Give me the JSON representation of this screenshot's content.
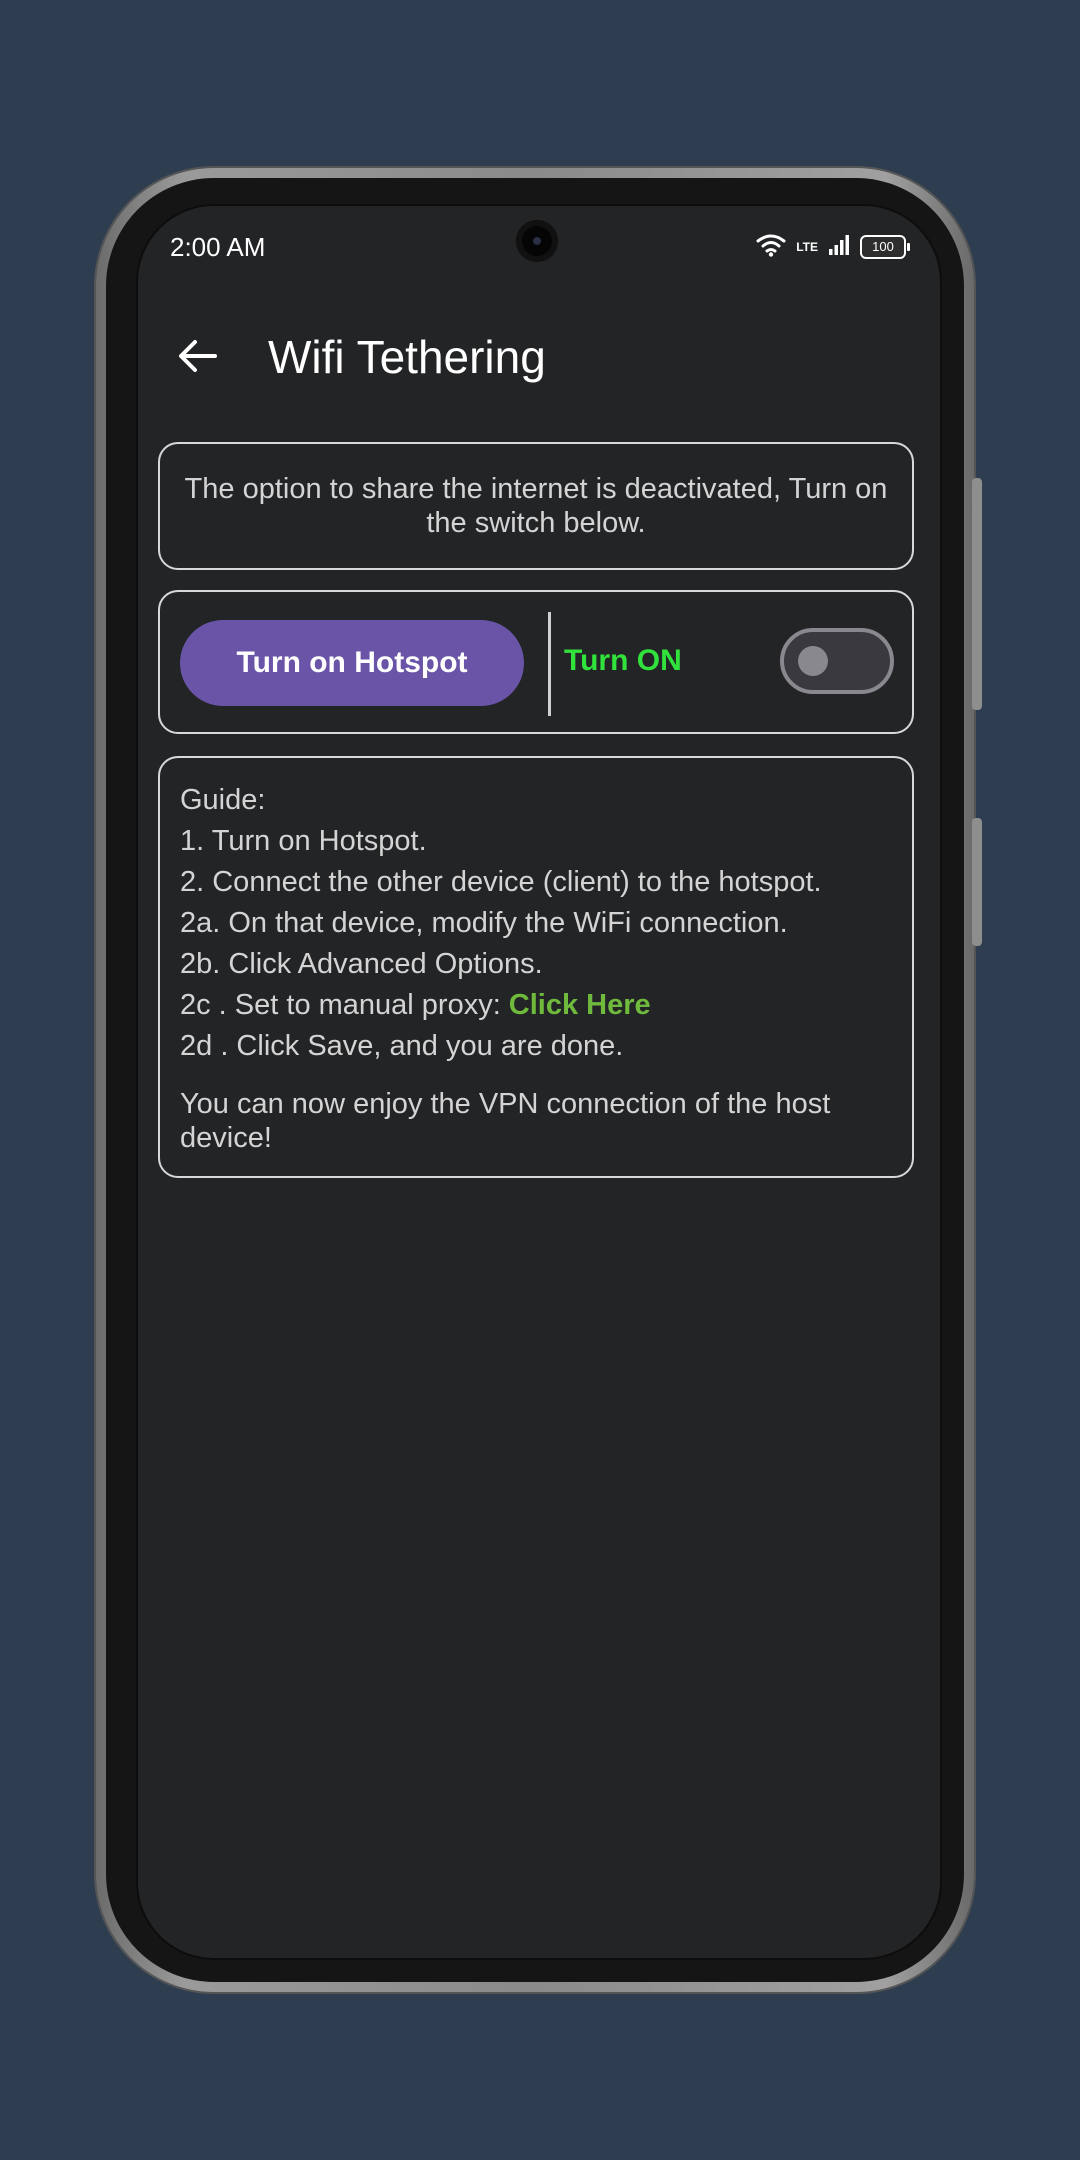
{
  "status_bar": {
    "time": "2:00 AM",
    "network": "LTE",
    "battery": "100",
    "icons": [
      "wifi-icon",
      "signal-icon",
      "battery-icon"
    ]
  },
  "app_bar": {
    "title": "Wifi Tethering",
    "back_icon": "arrow-left-icon"
  },
  "notice": {
    "text": "The option to share the internet is deactivated, Turn on the switch below."
  },
  "hotspot": {
    "button_label": "Turn on Hotspot",
    "toggle_label": "Turn ON",
    "toggle_state": "off"
  },
  "guide": {
    "title": "Guide:",
    "steps": [
      "1. Turn on Hotspot.",
      "2. Connect the other device (client) to the hotspot.",
      "2a. On that device, modify the WiFi connection.",
      "2b. Click Advanced Options.",
      "2c . Set to manual proxy:",
      "2d . Click Save, and you are done."
    ],
    "link_label": "Click Here",
    "footer": "You can now enjoy the VPN connection of the host device!"
  },
  "colors": {
    "background": "#2e3e50",
    "screen": "#232426",
    "accent_button": "#6a54a8",
    "turn_on_label": "#32e23c",
    "link": "#6fba3c"
  }
}
